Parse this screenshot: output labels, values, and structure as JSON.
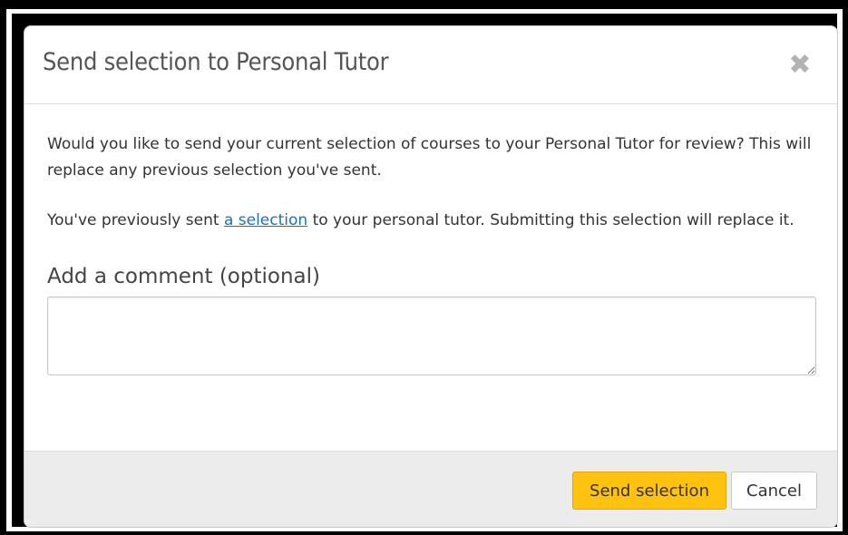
{
  "dialog": {
    "title": "Send selection to Personal Tutor",
    "close_icon": "close-icon",
    "close_glyph": "✖",
    "body": {
      "paragraph1": "Would you like to send your current selection of courses to your Personal Tutor for review? This will replace any previous selection you've sent.",
      "paragraph2_before": "You've previously sent ",
      "paragraph2_link": "a selection",
      "paragraph2_after": " to your personal tutor. Submitting this selection will replace it."
    },
    "comment": {
      "label": "Add a comment (optional)",
      "value": "",
      "placeholder": ""
    },
    "footer": {
      "send_label": "Send selection",
      "cancel_label": "Cancel"
    }
  },
  "colors": {
    "primary_button": "#ffc20e",
    "link": "#1a73b8",
    "footer_background": "#ececec"
  }
}
